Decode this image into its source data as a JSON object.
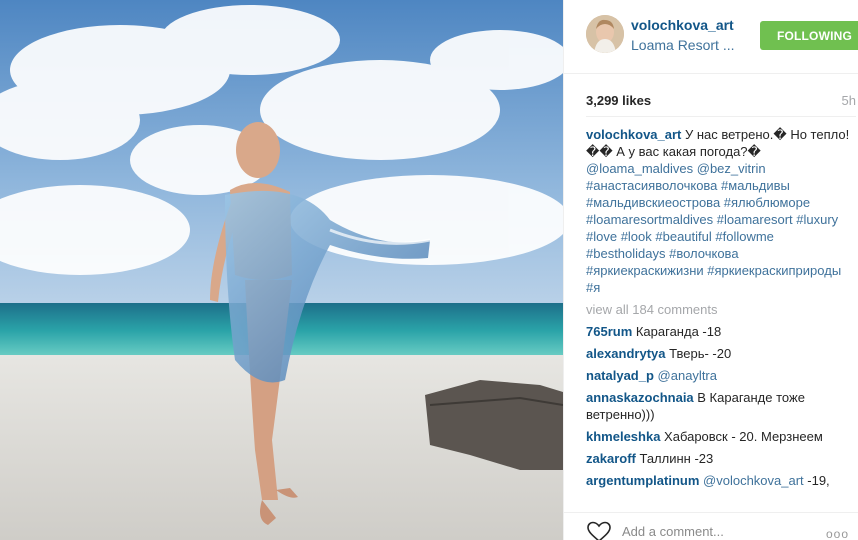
{
  "colors": {
    "follow_green": "#70c050",
    "username_blue": "#125688",
    "link_blue": "#3f729b",
    "muted_gray": "#a5a7aa"
  },
  "header": {
    "username": "volochkova_art",
    "location": "Loama Resort ...",
    "follow_label": "FOLLOWING",
    "avatar_icon": "avatar-photo"
  },
  "meta": {
    "likes": "3,299 likes",
    "time": "5h"
  },
  "caption": {
    "user": "volochkova_art",
    "text": " У нас ветрено.� Но тепло!�� А у вас какая погода?� ",
    "tags_line": "@loama_maldives @bez_vitrin #анастасияволочкова #мальдивы #мальдивскиеострова #ялюблюморе #loamaresortmaldives #loamaresort #luxury #love #look #beautiful #followme #bestholidays #волочкова #яркиекраскижизни #яркиекраскиприроды #я"
  },
  "view_all": "view all 184 comments",
  "comments": [
    {
      "user": "765rum",
      "text": " Караганда -18"
    },
    {
      "user": "alexandrytya",
      "text": " Тверь- -20"
    },
    {
      "user": "natalyad_p",
      "text": " ",
      "mention": "@anayltra"
    },
    {
      "user": "annaskazochnaia",
      "text": " В Караганде тоже ветренно)))"
    },
    {
      "user": "khmeleshka",
      "text": " Хабаровск - 20. Мерзнеем"
    },
    {
      "user": "zakaroff",
      "text": " Таллинн -23"
    },
    {
      "user": "argentumplatinum",
      "text": " -19,",
      "mention": " @volochkova_art"
    }
  ],
  "bottom": {
    "add_comment_placeholder": "Add a comment...",
    "more_label": "ooo",
    "like_icon": "heart-icon"
  }
}
